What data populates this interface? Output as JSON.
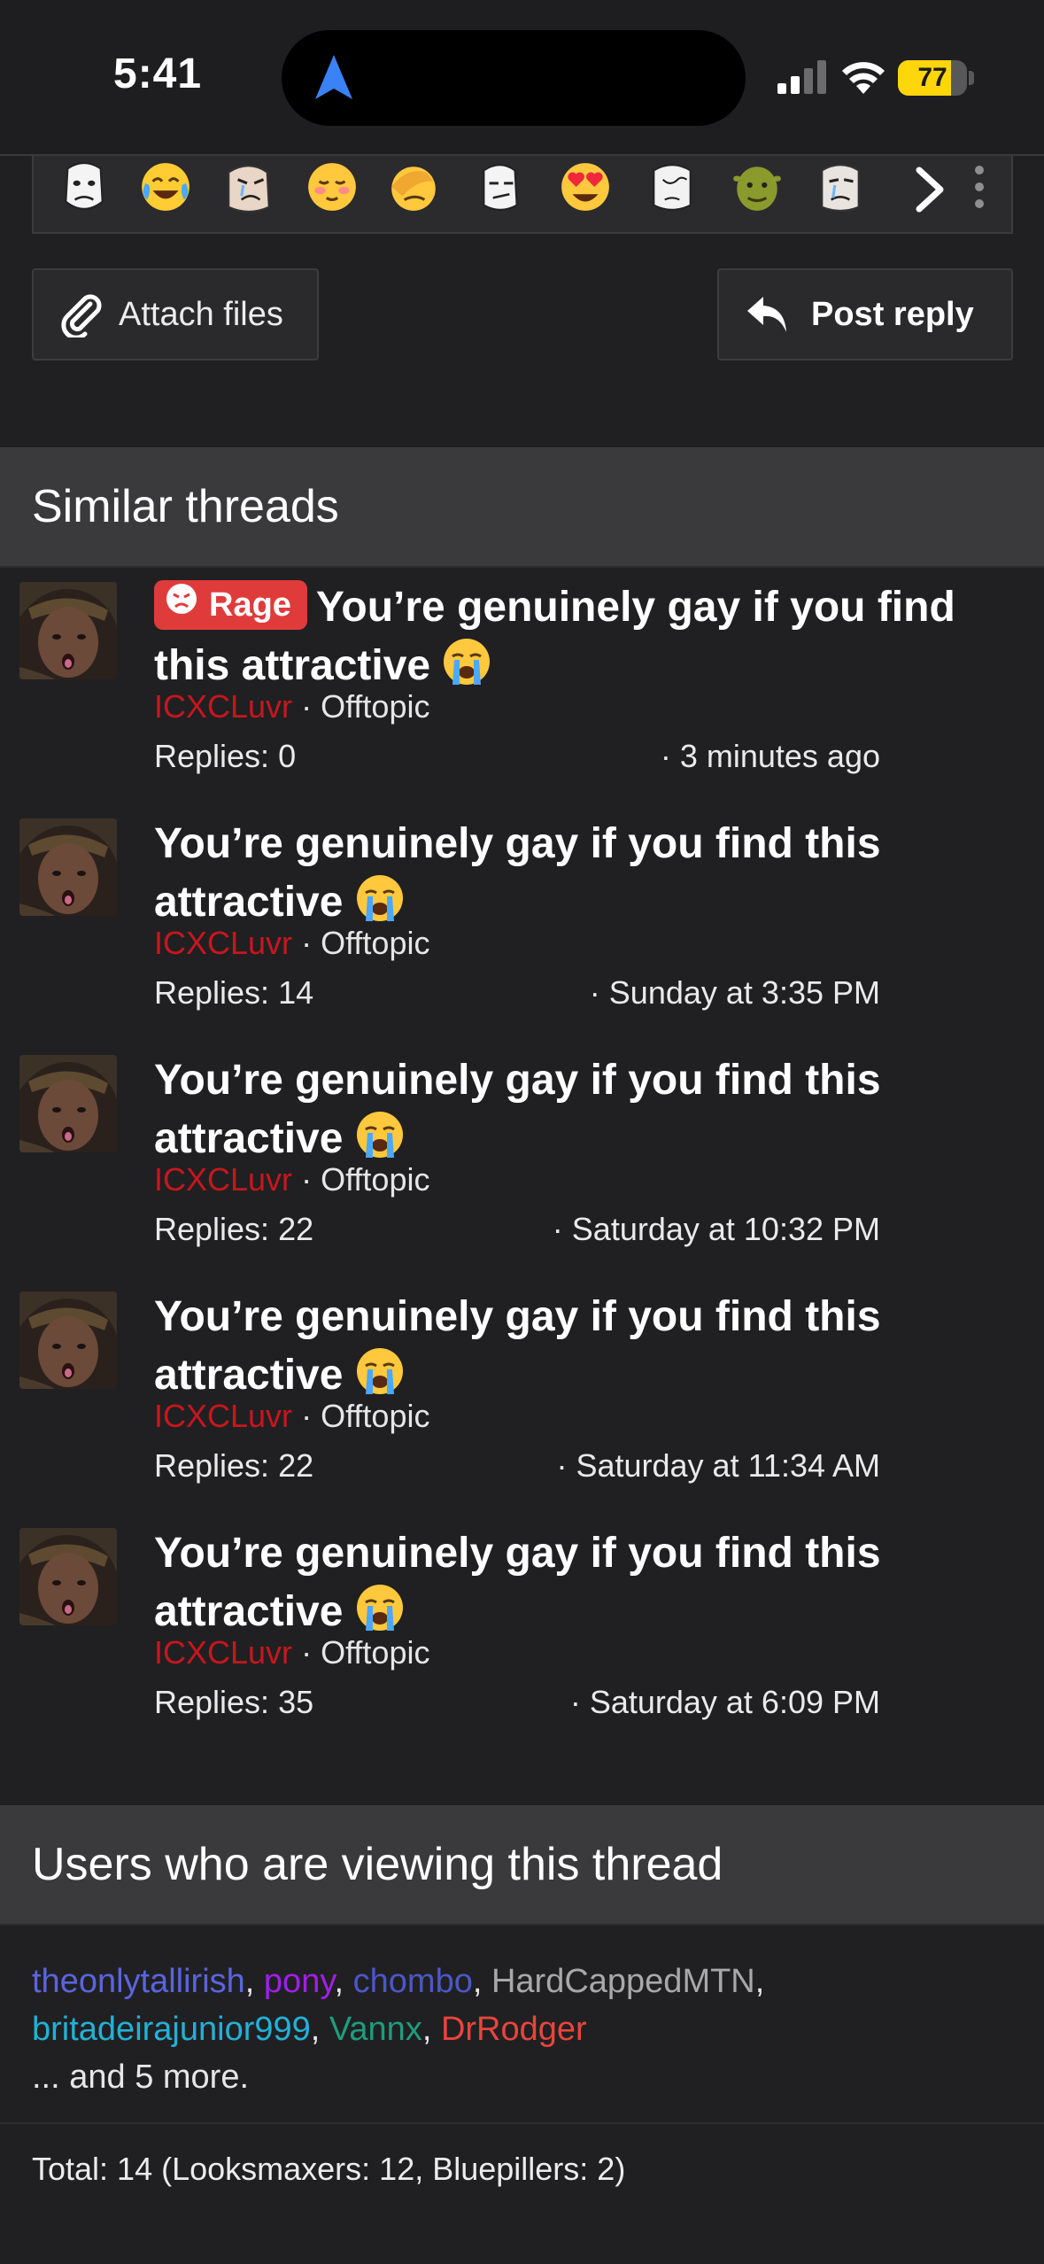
{
  "status_bar": {
    "time": "5:41",
    "battery": "77",
    "battery_level": 0.77,
    "battery_color": "#ffd60a",
    "location_icon": "navigation-arrow-icon"
  },
  "emoji_bar": {
    "icons": [
      "wojak-icon",
      "crying-laughing-icon",
      "crying-wojak-icon",
      "blushing-icon",
      "facepalm-icon",
      "smirk-wojak-icon",
      "heart-eyes-icon",
      "doomer-icon",
      "shrek-icon",
      "sad-wojak-icon"
    ],
    "next_icon": "chevron-right-icon",
    "more_icon": "vertical-ellipsis-icon"
  },
  "actions": {
    "attach_label": "Attach files",
    "reply_label": "Post reply"
  },
  "similar_threads": {
    "header": "Similar threads",
    "badge_label": "Rage",
    "badge_color": "#e03b3b",
    "items": [
      {
        "title": "You’re genuinely gay if you find this attractive",
        "has_badge": true,
        "author": "ICXCLuvr",
        "forum": "Offtopic",
        "replies": "Replies: 0",
        "date": "3 minutes ago"
      },
      {
        "title": "You’re genuinely gay if you find this attractive",
        "has_badge": false,
        "author": "ICXCLuvr",
        "forum": "Offtopic",
        "replies": "Replies: 14",
        "date": "Sunday at 3:35 PM"
      },
      {
        "title": "You’re genuinely gay if you find this attractive",
        "has_badge": false,
        "author": "ICXCLuvr",
        "forum": "Offtopic",
        "replies": "Replies: 22",
        "date": "Saturday at 10:32 PM"
      },
      {
        "title": "You’re genuinely gay if you find this attractive",
        "has_badge": false,
        "author": "ICXCLuvr",
        "forum": "Offtopic",
        "replies": "Replies: 22",
        "date": "Saturday at 11:34 AM"
      },
      {
        "title": "You’re genuinely gay if you find this attractive",
        "has_badge": false,
        "author": "ICXCLuvr",
        "forum": "Offtopic",
        "replies": "Replies: 35",
        "date": "Saturday at 6:09 PM"
      }
    ]
  },
  "viewers": {
    "header": "Users who are viewing this thread",
    "users": [
      {
        "name": "theonlytallirish",
        "color": "#5a64e0"
      },
      {
        "name": "pony",
        "color": "#a21ee6"
      },
      {
        "name": "chombo",
        "color": "#4b57c9"
      },
      {
        "name": "HardCappedMTN",
        "color": "#a8a8a8"
      },
      {
        "name": "britadeirajunior999",
        "color": "#22b1d6"
      },
      {
        "name": "Vannx",
        "color": "#1f9c7e"
      },
      {
        "name": "DrRodger",
        "color": "#e8453c"
      }
    ],
    "more": "... and 5 more.",
    "total": "Total: 14 (Looksmaxers: 12, Bluepillers: 2)"
  }
}
